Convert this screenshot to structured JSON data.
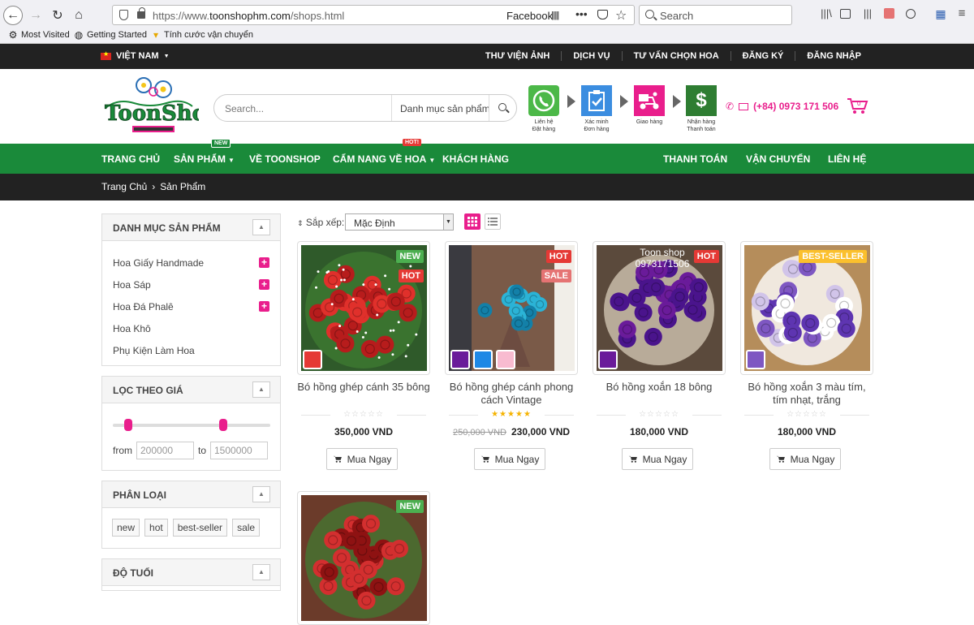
{
  "browser": {
    "url_scheme": "https://www.",
    "url_host": "toonshophm.com",
    "url_path": "/shops.html",
    "facebook_label": "Facebook",
    "search_placeholder": "Search",
    "bookmarks": [
      "Most Visited",
      "Getting Started",
      "Tính cước vận chuyển"
    ]
  },
  "topbar": {
    "language": "VIỆT NAM",
    "links": [
      "THƯ VIỆN ẢNH",
      "DỊCH VỤ",
      "TƯ VẤN CHỌN HOA",
      "ĐĂNG KÝ",
      "ĐĂNG NHẬP"
    ]
  },
  "header": {
    "search_placeholder": "Search...",
    "search_category": "Danh mục sản phẩm",
    "steps": [
      {
        "line1": "Liên hệ",
        "line2": "Đặt hàng",
        "color": "#4cb848",
        "icon": "phone-icon"
      },
      {
        "line1": "Xác minh",
        "line2": "Đơn hàng",
        "color": "#3b8de0",
        "icon": "clipboard-icon"
      },
      {
        "line1": "Giao hàng",
        "line2": "",
        "color": "#e91e8c",
        "icon": "delivery-icon"
      },
      {
        "line1": "Nhận hàng",
        "line2": "Thanh toán",
        "color": "#2e7d32",
        "icon": "dollar-icon"
      }
    ],
    "phone": "(+84) 0973 171 506",
    "cart_count": "0"
  },
  "nav": {
    "items": [
      "TRANG CHỦ",
      "SẢN PHẨM",
      "VỀ TOONSHOP",
      "CẨM NANG VỀ HOA",
      "KHÁCH HÀNG",
      "THANH TOÁN",
      "VẬN CHUYỂN",
      "LIÊN HỆ"
    ],
    "badge_new": "NEW",
    "badge_hot": "HOT!"
  },
  "breadcrumb": [
    "Trang Chủ",
    "Sản Phẩm"
  ],
  "sidebar": {
    "categories_title": "DANH MỤC SẢN PHẨM",
    "categories": [
      "Hoa Giấy Handmade",
      "Hoa Sáp",
      "Hoa Đá Phalê",
      "Hoa Khô",
      "Phụ Kiện Làm Hoa"
    ],
    "price_title": "LỌC THEO GIÁ",
    "price_from_label": "from",
    "price_to_label": "to",
    "price_from": "200000",
    "price_to": "1500000",
    "price_low_fraction": 0.1,
    "price_high_fraction": 0.7,
    "types_title": "PHÂN LOẠI",
    "types": [
      "new",
      "hot",
      "best-seller",
      "sale"
    ],
    "age_title": "ĐỘ TUỔI"
  },
  "sort": {
    "label": "Sắp xếp:",
    "value": "Mặc Định"
  },
  "products": [
    {
      "name": "Bó hồng ghép cánh 35 bông",
      "price": "350,000 VND",
      "old_price": "",
      "rating": "☆☆☆☆☆",
      "rating_color": "#ccc",
      "tags": [
        {
          "t": "NEW",
          "c": "#4caf50"
        },
        {
          "t": "HOT",
          "c": "#e53935"
        }
      ],
      "swatches": [
        "#e53935"
      ],
      "buy": "Mua Ngay",
      "theme": "red"
    },
    {
      "name": "Bó hồng ghép cánh phong cách Vintage",
      "price": "230,000 VND",
      "old_price": "250,000 VND",
      "rating": "★★★★★",
      "rating_color": "#f5b301",
      "tags": [
        {
          "t": "HOT",
          "c": "#e53935"
        },
        {
          "t": "SALE",
          "c": "#e57373"
        }
      ],
      "swatches": [
        "#6a1b9a",
        "#1e88e5",
        "#f8bbd0"
      ],
      "buy": "Mua Ngay",
      "theme": "blue"
    },
    {
      "name": "Bó hồng xoắn 18 bông",
      "price": "180,000 VND",
      "old_price": "",
      "rating": "☆☆☆☆☆",
      "rating_color": "#ccc",
      "tags": [
        {
          "t": "HOT",
          "c": "#e53935"
        }
      ],
      "swatches": [
        "#6a1b9a"
      ],
      "buy": "Mua Ngay",
      "theme": "purple",
      "overlay": "Toon shop 0973171506"
    },
    {
      "name": "Bó hồng xoắn 3 màu tím, tím nhạt, trắng",
      "price": "180,000 VND",
      "old_price": "",
      "rating": "☆☆☆☆☆",
      "rating_color": "#ccc",
      "tags": [
        {
          "t": "BEST-SELLER",
          "c": "#fbc02d"
        }
      ],
      "swatches": [
        "#7e57c2"
      ],
      "buy": "Mua Ngay",
      "theme": "mixed"
    },
    {
      "name": "",
      "price": "",
      "old_price": "",
      "rating": "",
      "rating_color": "#ccc",
      "tags": [
        {
          "t": "NEW",
          "c": "#4caf50"
        }
      ],
      "swatches": [],
      "buy": "",
      "theme": "red2"
    }
  ]
}
